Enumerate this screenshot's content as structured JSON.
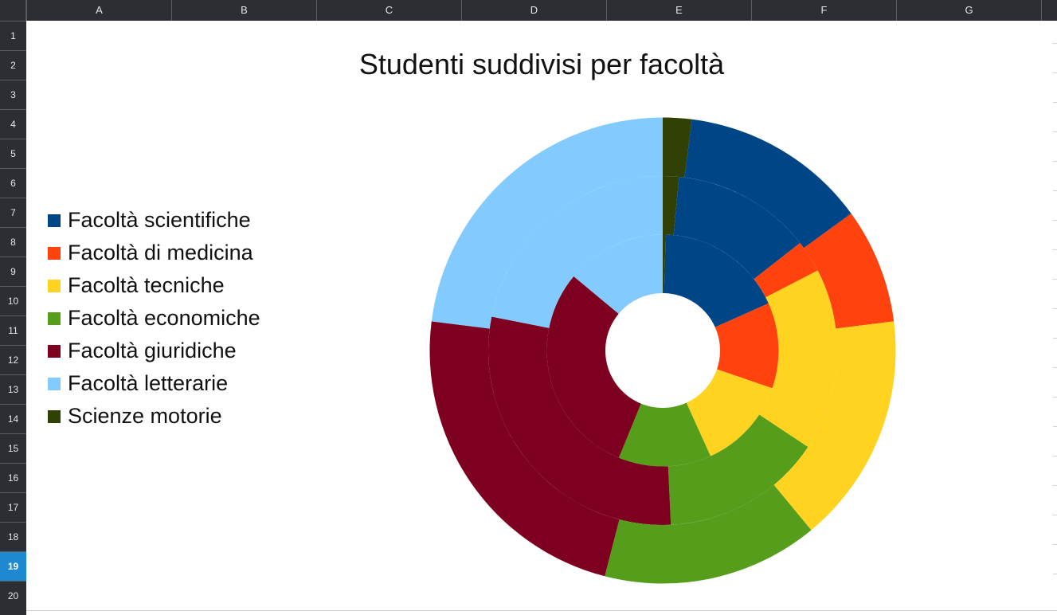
{
  "columns": [
    "A",
    "B",
    "C",
    "D",
    "E",
    "F",
    "G"
  ],
  "rows": [
    "1",
    "2",
    "3",
    "4",
    "5",
    "6",
    "7",
    "8",
    "9",
    "10",
    "11",
    "12",
    "13",
    "14",
    "15",
    "16",
    "17",
    "18",
    "19",
    "20"
  ],
  "active_row": "19",
  "chart_data": {
    "type": "donut",
    "title": "Studenti suddivisi per facoltà",
    "legend_position": "left",
    "categories": [
      "Facoltà scientifiche",
      "Facoltà di medicina",
      "Facoltà tecniche",
      "Facoltà economiche",
      "Facoltà giuridiche",
      "Facoltà letterarie",
      "Scienze motorie"
    ],
    "colors": [
      "#004586",
      "#ff420e",
      "#ffd320",
      "#579d1c",
      "#7e0021",
      "#83caff",
      "#314004"
    ],
    "series": [
      {
        "values": [
          18,
          12,
          13,
          13,
          30,
          14,
          0.4
        ]
      },
      {
        "values": [
          13,
          3,
          17,
          15,
          29,
          22,
          1.5
        ]
      },
      {
        "values": [
          13,
          8,
          16,
          15,
          23,
          23,
          2
        ]
      }
    ]
  }
}
